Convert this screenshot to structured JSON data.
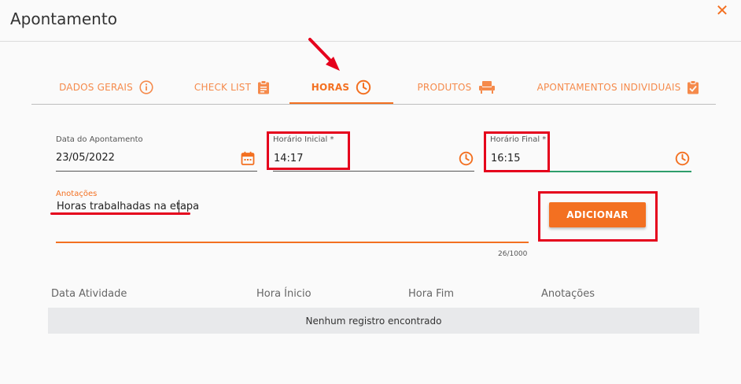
{
  "dialog": {
    "title": "Apontamento",
    "close_icon": "close-icon"
  },
  "tabs": [
    {
      "label": "DADOS GERAIS",
      "icon": "info-icon"
    },
    {
      "label": "CHECK LIST",
      "icon": "clipboard-icon"
    },
    {
      "label": "HORAS",
      "icon": "clock-icon",
      "active": true
    },
    {
      "label": "PRODUTOS",
      "icon": "chair-icon"
    },
    {
      "label": "APONTAMENTOS INDIVIDUAIS",
      "icon": "clipboard-check-icon"
    }
  ],
  "form": {
    "date": {
      "label": "Data do Apontamento",
      "value": "23/05/2022",
      "icon": "calendar-icon"
    },
    "start_time": {
      "label": "Horário Inicial *",
      "value": "14:17",
      "icon": "clock-icon"
    },
    "end_time": {
      "label": "Horário Final *",
      "value": "16:15",
      "icon": "clock-icon"
    },
    "notes": {
      "label": "Anotações",
      "value": "Horas trabalhadas na etapa",
      "counter": "26/1000"
    },
    "add_button": "ADICIONAR"
  },
  "table": {
    "columns": [
      "Data Atividade",
      "Hora Ínicio",
      "Hora Fim",
      "Anotações"
    ],
    "empty_message": "Nenhum registro encontrado"
  },
  "colors": {
    "accent": "#f37021",
    "highlight": "#e5001c",
    "focus": "#2e9e6b"
  }
}
